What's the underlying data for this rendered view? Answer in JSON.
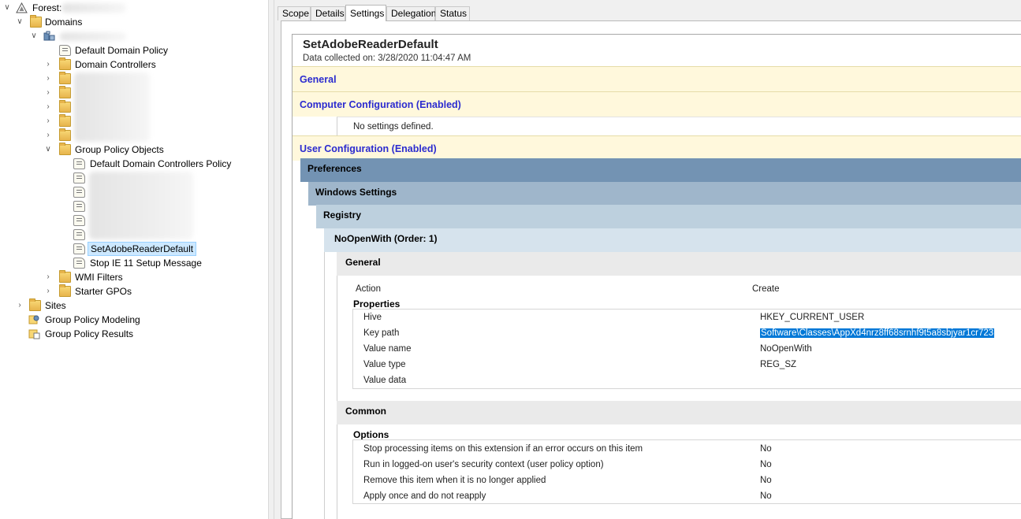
{
  "tree": {
    "forest_label": "Forest:",
    "domains_label": "Domains",
    "items": {
      "default_domain_policy": "Default Domain Policy",
      "domain_controllers": "Domain Controllers",
      "group_policy_objects": "Group Policy Objects",
      "default_dc_policy": "Default Domain Controllers Policy",
      "set_adobe": "SetAdobeReaderDefault",
      "stop_ie": "Stop IE 11 Setup Message",
      "wmi_filters": "WMI Filters",
      "starter_gpos": "Starter GPOs",
      "sites": "Sites",
      "gp_modeling": "Group Policy Modeling",
      "gp_results": "Group Policy Results"
    }
  },
  "tabs": [
    "Scope",
    "Details",
    "Settings",
    "Delegation",
    "Status"
  ],
  "active_tab": "Settings",
  "report": {
    "title": "SetAdobeReaderDefault",
    "collected": "Data collected on: 3/28/2020 11:04:47 AM",
    "general": "General",
    "computer_config": "Computer Configuration (Enabled)",
    "no_settings": "No settings defined.",
    "user_config": "User Configuration (Enabled)",
    "preferences": "Preferences",
    "windows_settings": "Windows Settings",
    "registry": "Registry",
    "item": "NoOpenWith (Order: 1)",
    "item_general": "General",
    "action_label": "Action",
    "action_value": "Create",
    "properties": "Properties",
    "props": [
      {
        "label": "Hive",
        "value": "HKEY_CURRENT_USER"
      },
      {
        "label": "Key path",
        "value": "Software\\Classes\\AppXd4nrz8ff68srnhf9t5a8sbjyar1cr723"
      },
      {
        "label": "Value name",
        "value": "NoOpenWith"
      },
      {
        "label": "Value type",
        "value": "REG_SZ"
      },
      {
        "label": "Value data",
        "value": ""
      }
    ],
    "common": "Common",
    "options": "Options",
    "opts": [
      {
        "label": "Stop processing items on this extension if an error occurs on this item",
        "value": "No"
      },
      {
        "label": "Run in logged-on user's security context (user policy option)",
        "value": "No"
      },
      {
        "label": "Remove this item when it is no longer applied",
        "value": "No"
      },
      {
        "label": "Apply once and do not reapply",
        "value": "No"
      }
    ]
  },
  "colors": {
    "yellow_band": "#fff8dc",
    "link_blue": "#2b2bcf",
    "preferences": "#7393b3",
    "windows_settings": "#9fb6cb",
    "registry": "#bdd0de",
    "item": "#d6e3ed",
    "selection": "#0078d7"
  }
}
